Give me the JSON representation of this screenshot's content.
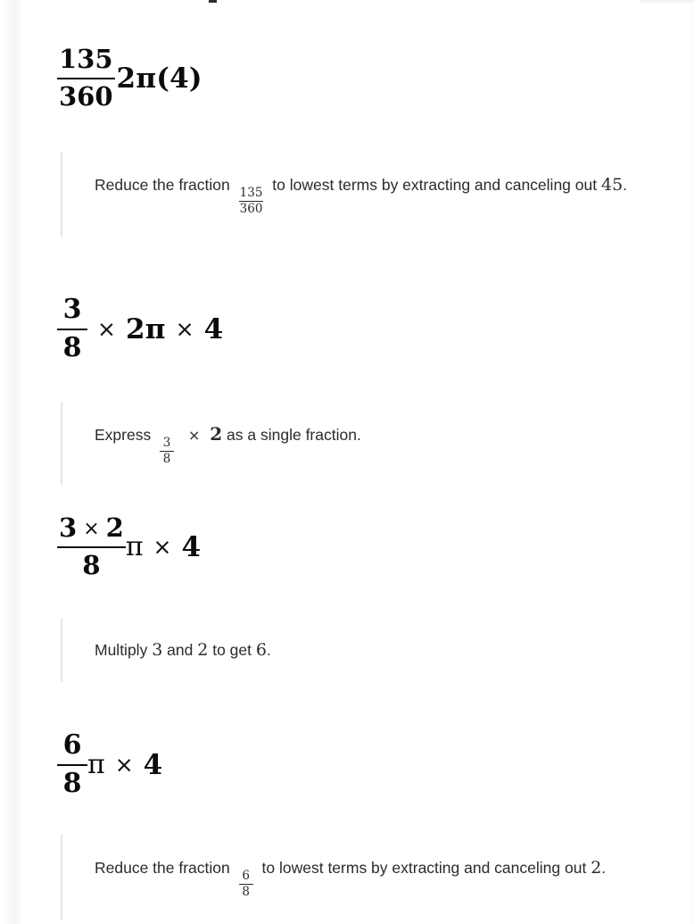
{
  "page": {
    "background": "#ffffff",
    "accent_bar_color": "#dfe7e9",
    "text_color": "#2b2b2b",
    "math_color": "#0b0b0b"
  },
  "solution": {
    "steps": [
      {
        "id": "step-1-expression",
        "kind": "expression",
        "latex": "\\frac{135}{360}2\\pi(4)",
        "fraction": {
          "numerator": "135",
          "denominator": "360"
        },
        "trailing": "2π(4)",
        "tokens": [
          "2",
          "π",
          "(",
          "4",
          ")"
        ]
      },
      {
        "id": "step-1-note",
        "kind": "note",
        "text_before": "Reduce the fraction",
        "inline_fraction": {
          "numerator": "135",
          "denominator": "360"
        },
        "text_after": "to lowest terms by extracting and canceling out",
        "value": "45",
        "period": ".",
        "full_text": "Reduce the fraction 135/360 to lowest terms by extracting and canceling out 45."
      },
      {
        "id": "step-2-expression",
        "kind": "expression",
        "latex": "\\frac{3}{8}\\times 2\\pi\\times 4",
        "fraction": {
          "numerator": "3",
          "denominator": "8"
        },
        "op1": "×",
        "mid": "2π",
        "op2": "×",
        "tail": "4"
      },
      {
        "id": "step-2-note",
        "kind": "note",
        "text_before": "Express",
        "inline_fraction": {
          "numerator": "3",
          "denominator": "8"
        },
        "operator": "×",
        "operand": "2",
        "text_after": "as a single fraction.",
        "full_text": "Express 3/8 × 2 as a single fraction."
      },
      {
        "id": "step-3-expression",
        "kind": "expression",
        "latex": "\\frac{3\\times 2}{8}\\pi\\times 4",
        "fraction": {
          "numerator_left": "3",
          "numerator_op": "×",
          "numerator_right": "2",
          "denominator": "8"
        },
        "after_fraction": "π",
        "op2": "×",
        "tail": "4"
      },
      {
        "id": "step-3-note",
        "kind": "note",
        "text_before": "Multiply",
        "a": "3",
        "text_mid": "and",
        "b": "2",
        "text_after": "to get",
        "result": "6",
        "period": ".",
        "full_text": "Multiply 3 and 2 to get 6."
      },
      {
        "id": "step-4-expression",
        "kind": "expression",
        "latex": "\\frac{6}{8}\\pi\\times 4",
        "fraction": {
          "numerator": "6",
          "denominator": "8"
        },
        "after_fraction": "π",
        "op2": "×",
        "tail": "4"
      },
      {
        "id": "step-4-note",
        "kind": "note",
        "text_before": "Reduce the fraction",
        "inline_fraction": {
          "numerator": "6",
          "denominator": "8"
        },
        "text_after": "to lowest terms by extracting and canceling out",
        "value": "2",
        "period": ".",
        "full_text": "Reduce the fraction 6/8 to lowest terms by extracting and canceling out 2."
      }
    ]
  }
}
